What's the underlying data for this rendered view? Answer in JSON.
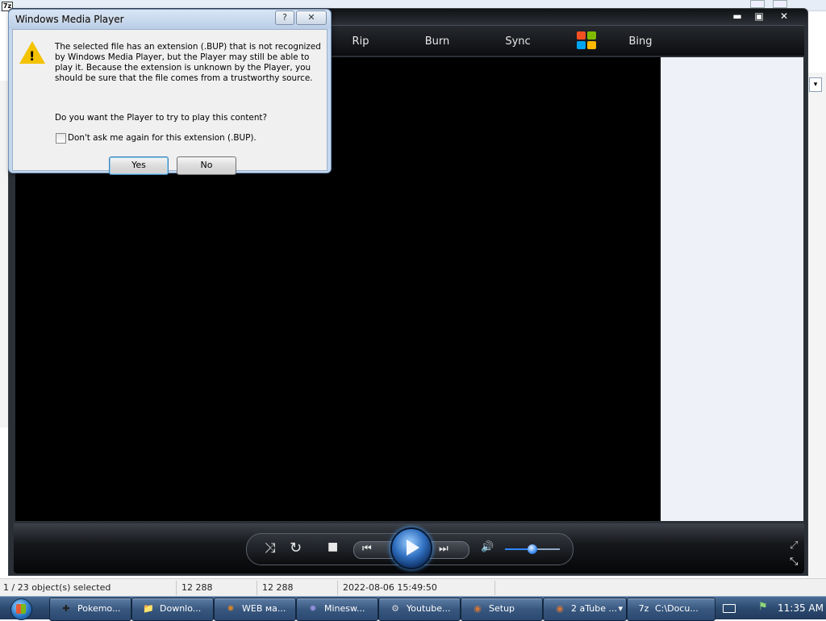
{
  "background_window": {
    "app_icon_text": "7z",
    "dropdown_arrow": "▾"
  },
  "statusbar": {
    "selection": "1 / 23 object(s) selected",
    "size": "12 288",
    "packed_size": "12 288",
    "modified": "2022-08-06 15:49:50"
  },
  "wmp": {
    "title_buttons": {
      "minimize": "▬",
      "maximize": "▣",
      "close": "✕"
    },
    "nav_tabs": [
      "Rip",
      "Burn",
      "Sync",
      "Bing"
    ],
    "icons": {
      "shuffle": "⤨",
      "repeat": "↻",
      "stop": "■",
      "previous": "⏮",
      "next": "⏭",
      "mute": "🔊",
      "switch_view": "⤢",
      "compact_view": "⤡"
    },
    "volume_level": 0.5
  },
  "dialog": {
    "title": "Windows Media Player",
    "help_button": "?",
    "close_button": "✕",
    "warning_mark": "!",
    "message": "The selected file has an extension (.BUP) that is not recognized by Windows Media Player, but the Player may still be able to play it. Because the extension is unknown by the Player, you should be sure that the file comes from a trustworthy source.",
    "question": "Do you want the Player to try to play this content?",
    "checkbox_label": "Don't ask me again for this extension (.BUP).",
    "yes_label": "Yes",
    "no_label": "No"
  },
  "taskbar": {
    "items": [
      {
        "label": "Pokemo...",
        "icon": "✚",
        "icon_color": "#222222"
      },
      {
        "label": "Downlo...",
        "icon": "📁",
        "icon_color": "#e8c46a"
      },
      {
        "label": "WEB ма...",
        "icon": "✸",
        "icon_color": "#c9822e"
      },
      {
        "label": "Minesw...",
        "icon": "✹",
        "icon_color": "#8e8ed8"
      },
      {
        "label": "Youtube...",
        "icon": "⚙",
        "icon_color": "#d8d8d8"
      },
      {
        "label": "Setup",
        "icon": "◉",
        "icon_color": "#d2763a"
      },
      {
        "label": "2  aTube ...",
        "icon": "◉",
        "icon_color": "#d2763a",
        "dropdown": "▾"
      },
      {
        "label": "C:\\Docu...",
        "icon": "7z",
        "icon_color": "#ffffff"
      }
    ],
    "clock": "11:35 AM"
  }
}
